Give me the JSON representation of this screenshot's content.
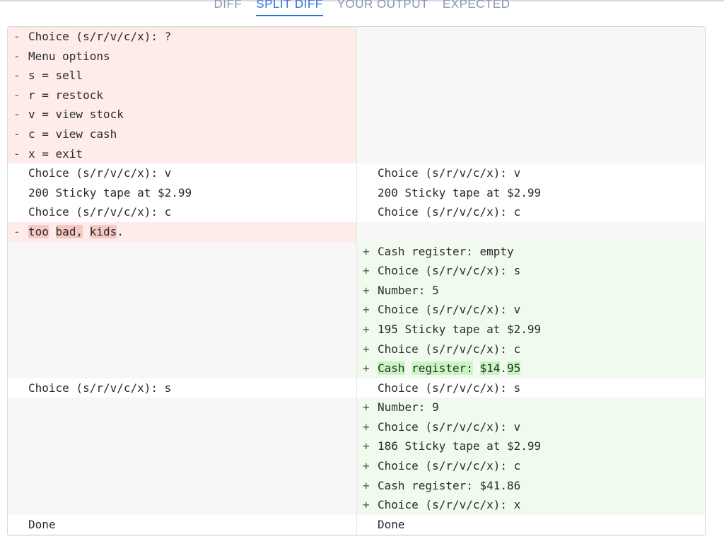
{
  "tabs": [
    {
      "label": "DIFF"
    },
    {
      "label": "SPLIT DIFF"
    },
    {
      "label": "YOUR OUTPUT"
    },
    {
      "label": "EXPECTED"
    }
  ],
  "active_tab": "SPLIT DIFF",
  "colors": {
    "accent": "#2f6fdd",
    "deleted_bg": "#fdecea",
    "added_bg": "#f0fbee",
    "deleted_word": "#f7c7c3",
    "added_word": "#c8f5c2"
  },
  "left": {
    "lines": [
      {
        "type": "del",
        "marker": "-",
        "text": "Choice (s/r/v/c/x): ?"
      },
      {
        "type": "del",
        "marker": "-",
        "text": "Menu options"
      },
      {
        "type": "del",
        "marker": "-",
        "text": "s = sell"
      },
      {
        "type": "del",
        "marker": "-",
        "text": "r = restock"
      },
      {
        "type": "del",
        "marker": "-",
        "text": "v = view stock"
      },
      {
        "type": "del",
        "marker": "-",
        "text": "c = view cash"
      },
      {
        "type": "del",
        "marker": "-",
        "text": "x = exit"
      },
      {
        "type": "same",
        "marker": "",
        "text": "Choice (s/r/v/c/x): v"
      },
      {
        "type": "same",
        "marker": "",
        "text": "200 Sticky tape at $2.99"
      },
      {
        "type": "same",
        "marker": "",
        "text": "Choice (s/r/v/c/x): c"
      },
      {
        "type": "del",
        "marker": "-",
        "segments": [
          {
            "t": "too",
            "hl": true
          },
          {
            "t": " ",
            "hl": false
          },
          {
            "t": "bad,",
            "hl": true
          },
          {
            "t": " ",
            "hl": false
          },
          {
            "t": "kids",
            "hl": true
          },
          {
            "t": ".",
            "hl": false
          }
        ]
      },
      {
        "type": "empty"
      },
      {
        "type": "empty"
      },
      {
        "type": "empty"
      },
      {
        "type": "empty"
      },
      {
        "type": "empty"
      },
      {
        "type": "empty"
      },
      {
        "type": "empty"
      },
      {
        "type": "same",
        "marker": "",
        "text": "Choice (s/r/v/c/x): s"
      },
      {
        "type": "empty"
      },
      {
        "type": "empty"
      },
      {
        "type": "empty"
      },
      {
        "type": "empty"
      },
      {
        "type": "empty"
      },
      {
        "type": "empty"
      },
      {
        "type": "same",
        "marker": "",
        "text": "Done"
      }
    ]
  },
  "right": {
    "lines": [
      {
        "type": "empty"
      },
      {
        "type": "empty"
      },
      {
        "type": "empty"
      },
      {
        "type": "empty"
      },
      {
        "type": "empty"
      },
      {
        "type": "empty"
      },
      {
        "type": "empty"
      },
      {
        "type": "same",
        "marker": "",
        "text": "Choice (s/r/v/c/x): v"
      },
      {
        "type": "same",
        "marker": "",
        "text": "200 Sticky tape at $2.99"
      },
      {
        "type": "same",
        "marker": "",
        "text": "Choice (s/r/v/c/x): c"
      },
      {
        "type": "empty"
      },
      {
        "type": "add",
        "marker": "+",
        "text": "Cash register: empty"
      },
      {
        "type": "add",
        "marker": "+",
        "text": "Choice (s/r/v/c/x): s"
      },
      {
        "type": "add",
        "marker": "+",
        "text": "Number: 5"
      },
      {
        "type": "add",
        "marker": "+",
        "text": "Choice (s/r/v/c/x): v"
      },
      {
        "type": "add",
        "marker": "+",
        "text": "195 Sticky tape at $2.99"
      },
      {
        "type": "add",
        "marker": "+",
        "text": "Choice (s/r/v/c/x): c"
      },
      {
        "type": "add",
        "marker": "+",
        "segments": [
          {
            "t": "Cash",
            "hl": true
          },
          {
            "t": " ",
            "hl": false
          },
          {
            "t": "register:",
            "hl": true
          },
          {
            "t": " ",
            "hl": false
          },
          {
            "t": "$14",
            "hl": true
          },
          {
            "t": ".",
            "hl": false
          },
          {
            "t": "95",
            "hl": true
          }
        ]
      },
      {
        "type": "same",
        "marker": "",
        "text": "Choice (s/r/v/c/x): s"
      },
      {
        "type": "add",
        "marker": "+",
        "text": "Number: 9"
      },
      {
        "type": "add",
        "marker": "+",
        "text": "Choice (s/r/v/c/x): v"
      },
      {
        "type": "add",
        "marker": "+",
        "text": "186 Sticky tape at $2.99"
      },
      {
        "type": "add",
        "marker": "+",
        "text": "Choice (s/r/v/c/x): c"
      },
      {
        "type": "add",
        "marker": "+",
        "text": "Cash register: $41.86"
      },
      {
        "type": "add",
        "marker": "+",
        "text": "Choice (s/r/v/c/x): x"
      },
      {
        "type": "same",
        "marker": "",
        "text": "Done"
      }
    ]
  }
}
